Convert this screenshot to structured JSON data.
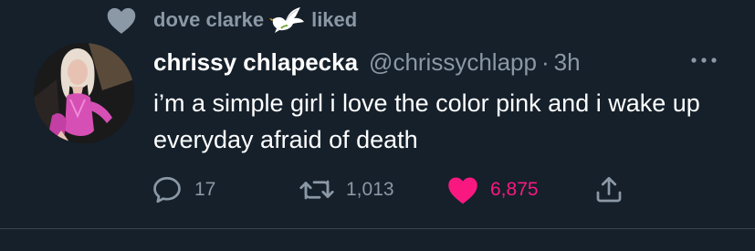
{
  "social_context": {
    "user": "dove clarke",
    "action": "liked",
    "icon": "dove-emoji"
  },
  "tweet": {
    "display_name": "chrissy chlapecka",
    "handle": "@chrissychlapp",
    "separator": "·",
    "time": "3h",
    "text": "i’m a simple girl i love the color pink and i wake up everyday afraid of death"
  },
  "actions": {
    "reply_count": "17",
    "retweet_count": "1,013",
    "like_count": "6,875"
  },
  "colors": {
    "background": "#15202b",
    "muted": "#8b98a5",
    "like": "#f91880",
    "divider": "#38444d"
  }
}
